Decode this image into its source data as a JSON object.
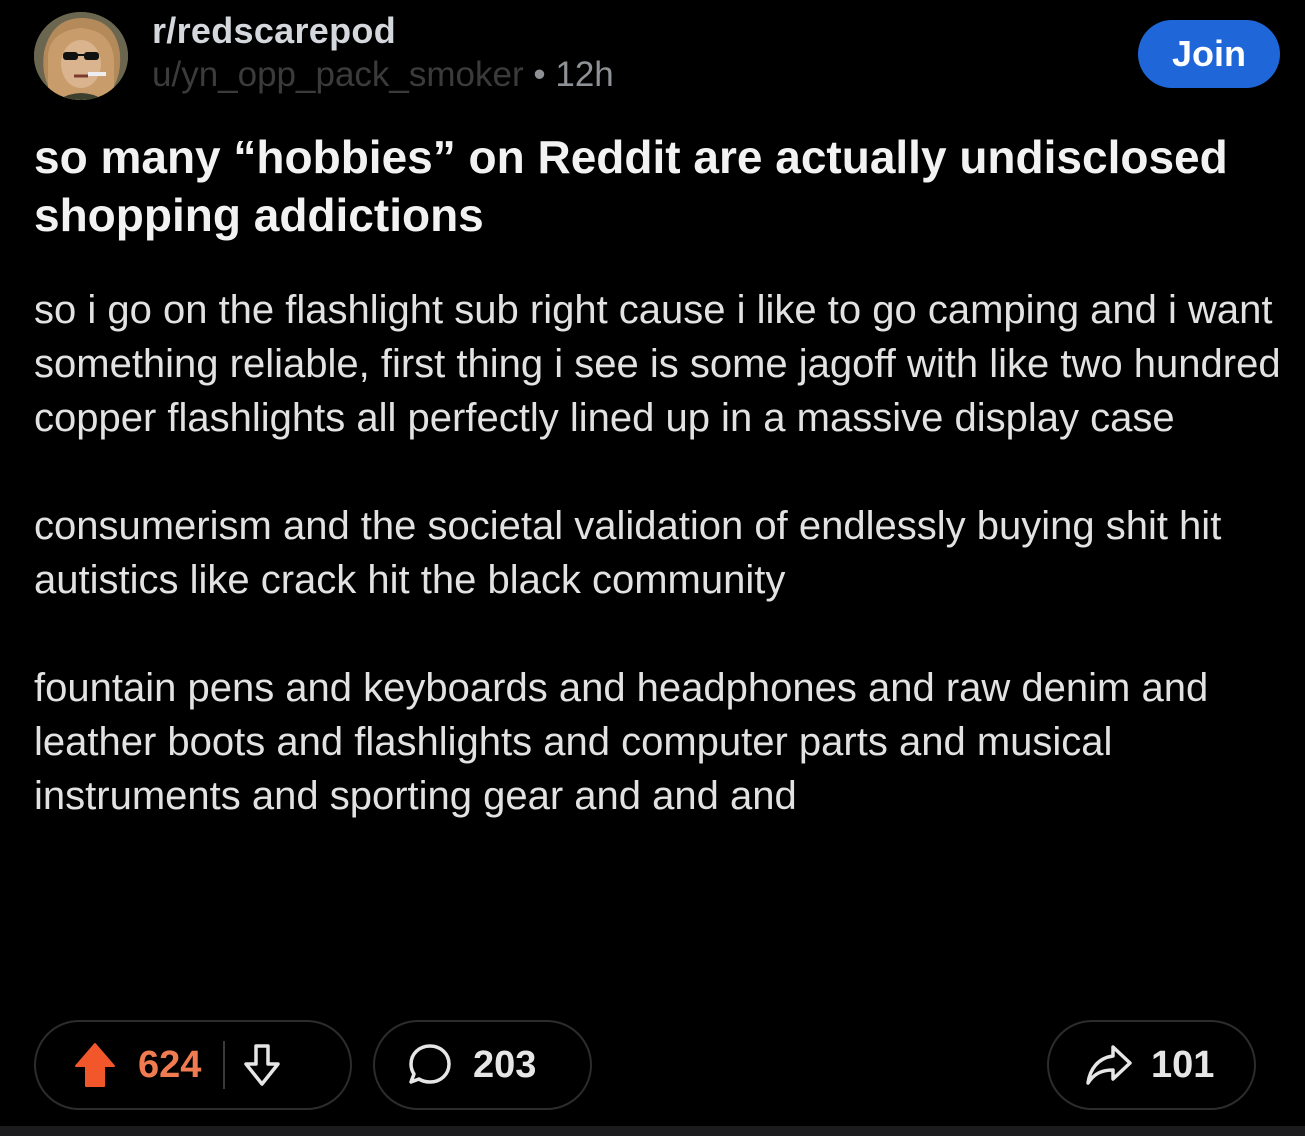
{
  "colors": {
    "background": "#000000",
    "join_button": "#1f67d8",
    "upvote_active": "#f07b50",
    "pill_border": "#2c2c2e"
  },
  "header": {
    "subreddit": "r/redscarepod",
    "username": "u/yn_opp_pack_smoker",
    "separator": "•",
    "timestamp": "12h",
    "join_label": "Join"
  },
  "post": {
    "title": "so many “hobbies” on Reddit are actually undisclosed shopping addictions",
    "paragraphs": [
      "so i go on the flashlight sub right cause i like to go camping and i want something reliable, first thing i see is some jagoff with like two hundred copper flashlights all perfectly lined up in a massive display case",
      "consumerism and the societal validation of endlessly buying shit hit autistics like crack hit the black community",
      "fountain pens and keyboards and headphones and raw denim and leather boots and flashlights and computer parts and musical instruments and sporting gear and and and"
    ]
  },
  "actions": {
    "upvotes": "624",
    "comments": "203",
    "shares": "101",
    "icons": {
      "upvote": "arrow-up-icon",
      "downvote": "arrow-down-icon",
      "comment": "speech-bubble-icon",
      "share": "share-arrow-icon"
    }
  }
}
